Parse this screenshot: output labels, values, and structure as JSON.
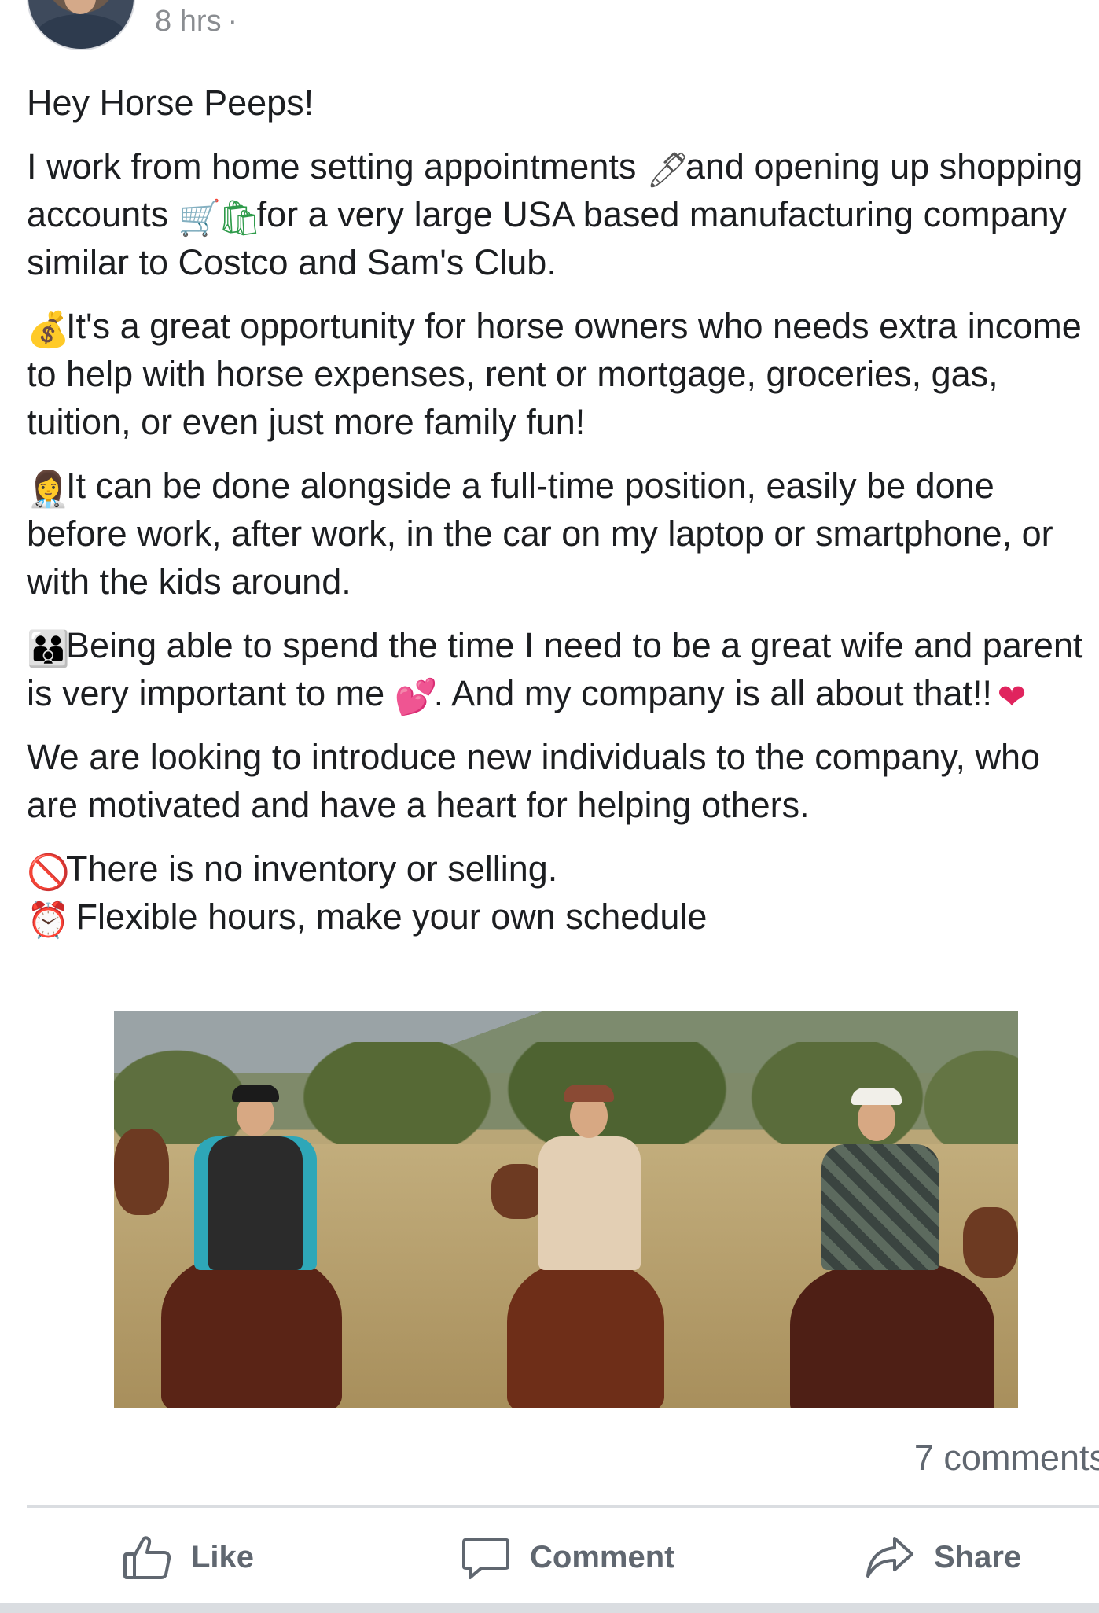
{
  "post": {
    "timestamp": "8 hrs",
    "timestamp_separator": "·",
    "greeting": "Hey Horse Peeps!",
    "paragraph_1": {
      "part_a": "I work from home setting appointments ",
      "emoji_pen": "🖊",
      "part_b": "and opening up shopping accounts ",
      "emoji_cart": "🛒",
      "emoji_bags": "🛍",
      "part_c": "for a very large USA based manufacturing company similar to Costco and Sam's Club."
    },
    "paragraph_2": {
      "emoji": "💰",
      "text": "It's a great opportunity for horse owners who needs extra income to help with horse expenses, rent or mortgage, groceries, gas, tuition, or even just more family fun!"
    },
    "paragraph_3": {
      "emoji": "👩‍⚕️",
      "text": "It can be done alongside a full-time position, easily be done before work, after work, in the car on my laptop or smartphone, or with the kids around."
    },
    "paragraph_4": {
      "emoji_family": "👪",
      "part_a": "Being able to spend the time I need to be a great wife and parent is very important to me ",
      "emoji_hearts": "💕",
      "part_b": ". And my company is all about that!!",
      "emoji_heart": "❤"
    },
    "paragraph_5": "We are looking to introduce new individuals to the company, who are motivated and have a heart for helping others.",
    "bullet_1": {
      "emoji": "🚫",
      "text": "There is no inventory or selling."
    },
    "bullet_2": {
      "emoji": "⏰",
      "text": " Flexible hours, make your own schedule"
    }
  },
  "comments_count": "7 comments",
  "actions": {
    "like_label": "Like",
    "comment_label": "Comment",
    "share_label": "Share"
  },
  "colors": {
    "text": "#1c1e21",
    "secondary": "#606770",
    "divider": "#dadde1"
  }
}
